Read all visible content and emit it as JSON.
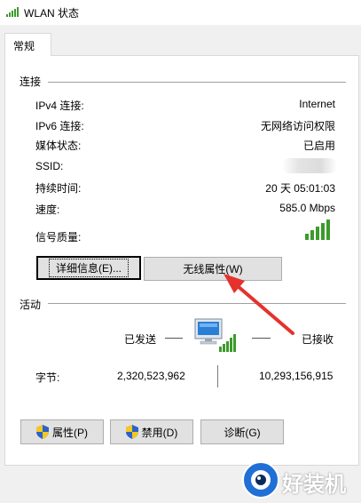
{
  "window": {
    "title": "WLAN 状态",
    "icon": "wifi-signal-icon"
  },
  "tabs": [
    {
      "label": "常规",
      "selected": true
    }
  ],
  "connection": {
    "section_label": "连接",
    "rows": [
      {
        "label": "IPv4 连接:",
        "value": "Internet"
      },
      {
        "label": "IPv6 连接:",
        "value": "无网络访问权限"
      },
      {
        "label": "媒体状态:",
        "value": "已启用"
      },
      {
        "label": "SSID:",
        "value": ""
      },
      {
        "label": "持续时间:",
        "value": "20 天 05:01:03"
      },
      {
        "label": "速度:",
        "value": "585.0 Mbps"
      }
    ],
    "signal_label": "信号质量:",
    "signal_bars_active": 5,
    "signal_bars_total": 5,
    "signal_color": "#3d9a2c",
    "details_button": "详细信息(E)...",
    "wireless_props_button": "无线属性(W)"
  },
  "activity": {
    "section_label": "活动",
    "sent_label": "已发送",
    "received_label": "已接收",
    "bytes_label": "字节:",
    "bytes_sent": "2,320,523,962",
    "bytes_received": "10,293,156,915"
  },
  "buttons": {
    "properties": "属性(P)",
    "disable": "禁用(D)",
    "diagnose": "诊断(G)"
  },
  "annotation": {
    "arrow_color": "#e5322d"
  },
  "watermark": {
    "text": "好装机"
  }
}
